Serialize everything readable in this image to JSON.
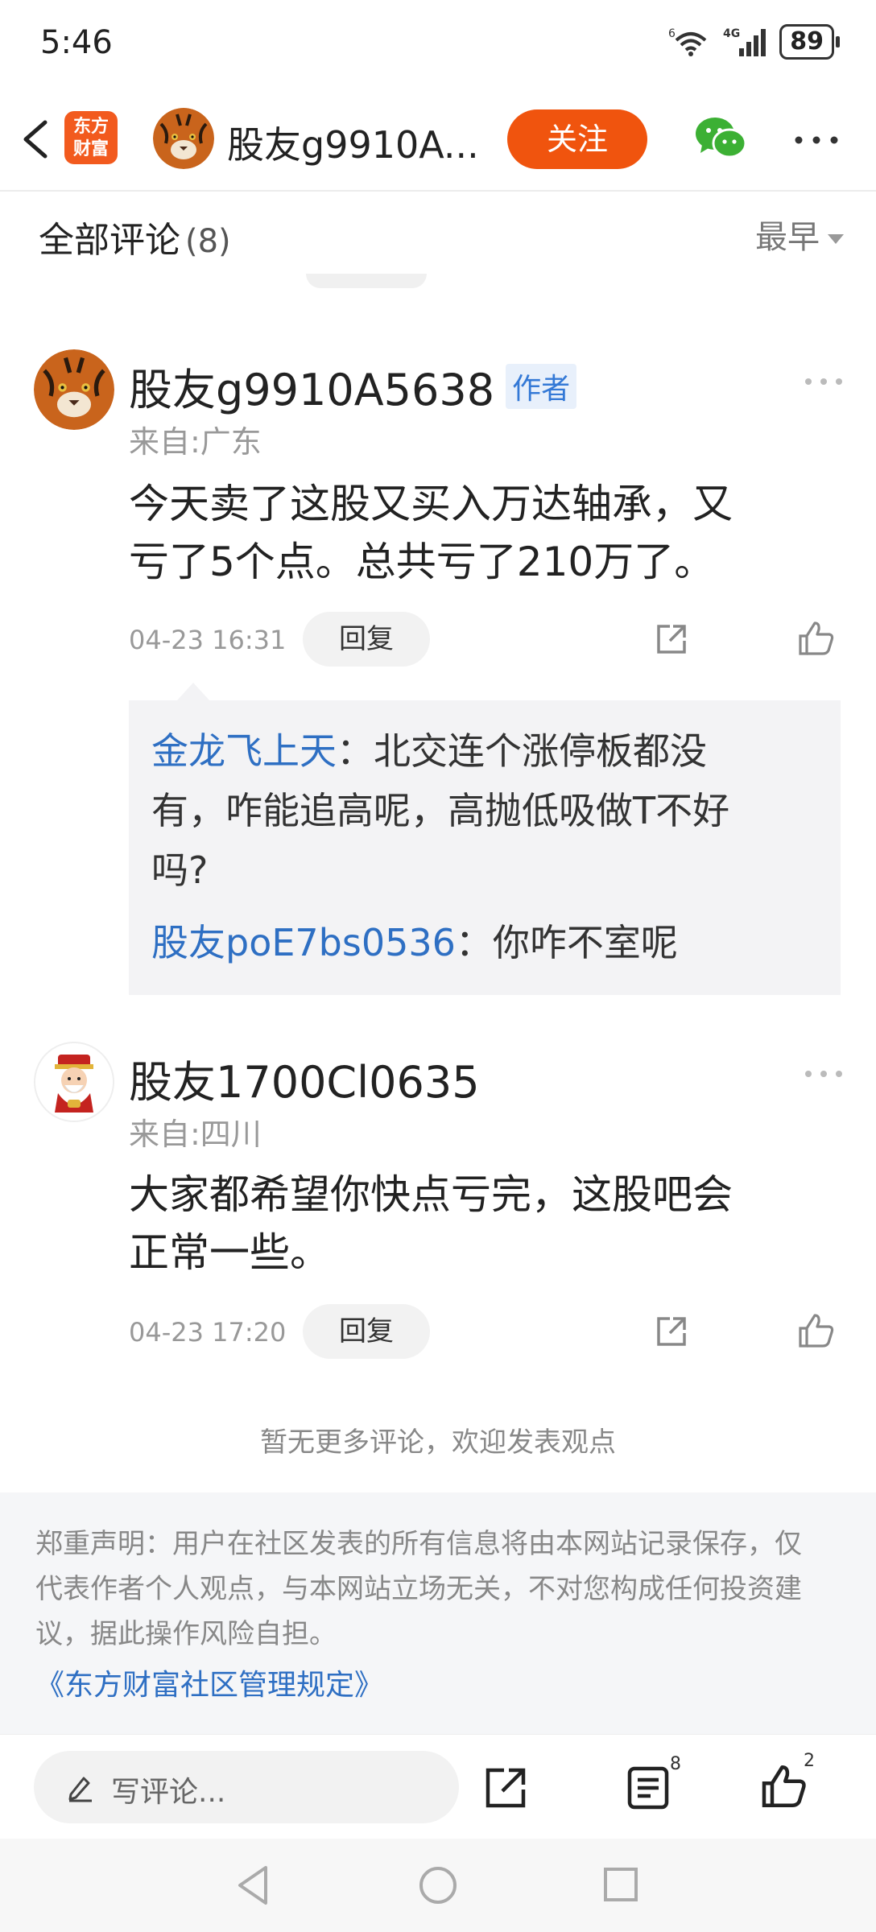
{
  "status_bar": {
    "time": "5:46",
    "network": "4G",
    "wifi_label": "6",
    "battery": "89"
  },
  "header": {
    "logo_line1": "东方",
    "logo_line2": "财富",
    "username": "股友g9910A...",
    "follow_label": "关注"
  },
  "comments_header": {
    "title": "全部评论",
    "count": "(8)",
    "sort_label": "最早"
  },
  "comments": [
    {
      "username": "股友g9910A5638",
      "author_tag": "作者",
      "from": "来自:广东",
      "text_line1": "今天卖了这股又买入万达轴承，又",
      "text_line2": "亏了5个点。总共亏了210万了。",
      "time": "04-23 16:31",
      "reply_label": "回复",
      "replies": [
        {
          "name": "金龙飞上天",
          "sep": "：",
          "text_line1": "北交连个涨停板都没",
          "text_line2": "有，咋能追高呢，高抛低吸做T不好",
          "text_line3": "吗?"
        },
        {
          "name": "股友poE7bs0536",
          "sep": "：",
          "text": "你咋不室呢"
        }
      ]
    },
    {
      "username": "股友1700Cl0635",
      "from": "来自:四川",
      "text_line1": "大家都希望你快点亏完，这股吧会",
      "text_line2": "正常一些。",
      "time": "04-23 17:20",
      "reply_label": "回复"
    }
  ],
  "no_more": "暂无更多评论，欢迎发表观点",
  "disclaimer": {
    "line1": "郑重声明：用户在社区发表的所有信息将由本网站记录保存，仅",
    "line2": "代表作者个人观点，与本网站立场无关，不对您构成任何投资建",
    "line3": "议，据此操作风险自担。",
    "link": "《东方财富社区管理规定》"
  },
  "bottom_bar": {
    "write_placeholder": "写评论...",
    "comment_count": "8",
    "like_count": "2"
  },
  "colors": {
    "accent": "#f0540e",
    "link": "#2e6fc3",
    "author_tag_bg": "#e8f0fb"
  }
}
